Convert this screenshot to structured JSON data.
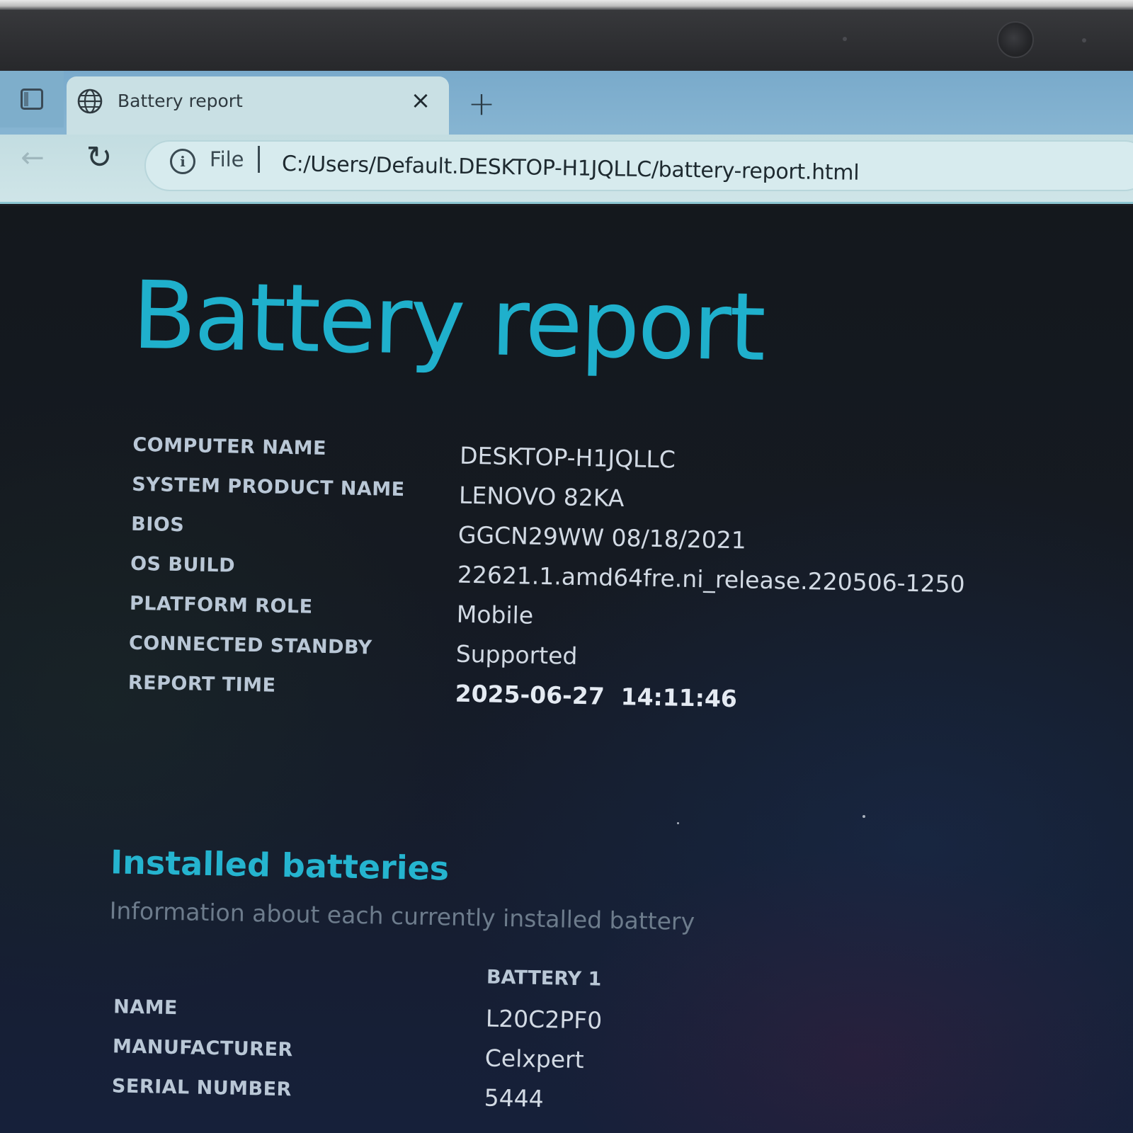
{
  "browser": {
    "tab": {
      "title": "Battery report",
      "close_glyph": "×"
    },
    "new_tab_glyph": "+",
    "nav": {
      "back_glyph": "←",
      "reload_glyph": "↻"
    },
    "address": {
      "scheme_label": "File",
      "info_glyph": "i",
      "url": "C:/Users/Default.DESKTOP-H1JQLLC/battery-report.html"
    }
  },
  "report": {
    "title": "Battery report",
    "system_info": [
      {
        "key": "COMPUTER NAME",
        "value": "DESKTOP-H1JQLLC"
      },
      {
        "key": "SYSTEM PRODUCT NAME",
        "value": "LENOVO 82KA"
      },
      {
        "key": "BIOS",
        "value": "GGCN29WW 08/18/2021"
      },
      {
        "key": "OS BUILD",
        "value": "22621.1.amd64fre.ni_release.220506-1250"
      },
      {
        "key": "PLATFORM ROLE",
        "value": "Mobile"
      },
      {
        "key": "CONNECTED STANDBY",
        "value": "Supported"
      },
      {
        "key": "REPORT TIME",
        "value": "2025-06-27  14:11:46"
      }
    ],
    "installed_batteries": {
      "title": "Installed batteries",
      "subtitle": "Information about each currently installed battery",
      "column_header": "BATTERY 1",
      "rows": [
        {
          "key": "NAME",
          "value": "L20C2PF0"
        },
        {
          "key": "MANUFACTURER",
          "value": "Celxpert"
        },
        {
          "key": "SERIAL NUMBER",
          "value": "5444"
        }
      ]
    }
  },
  "colors": {
    "accent": "#1fb0cc",
    "page_background": "#151a22",
    "tab_bar": "#79aacb",
    "active_tab": "#c9e0e4"
  }
}
